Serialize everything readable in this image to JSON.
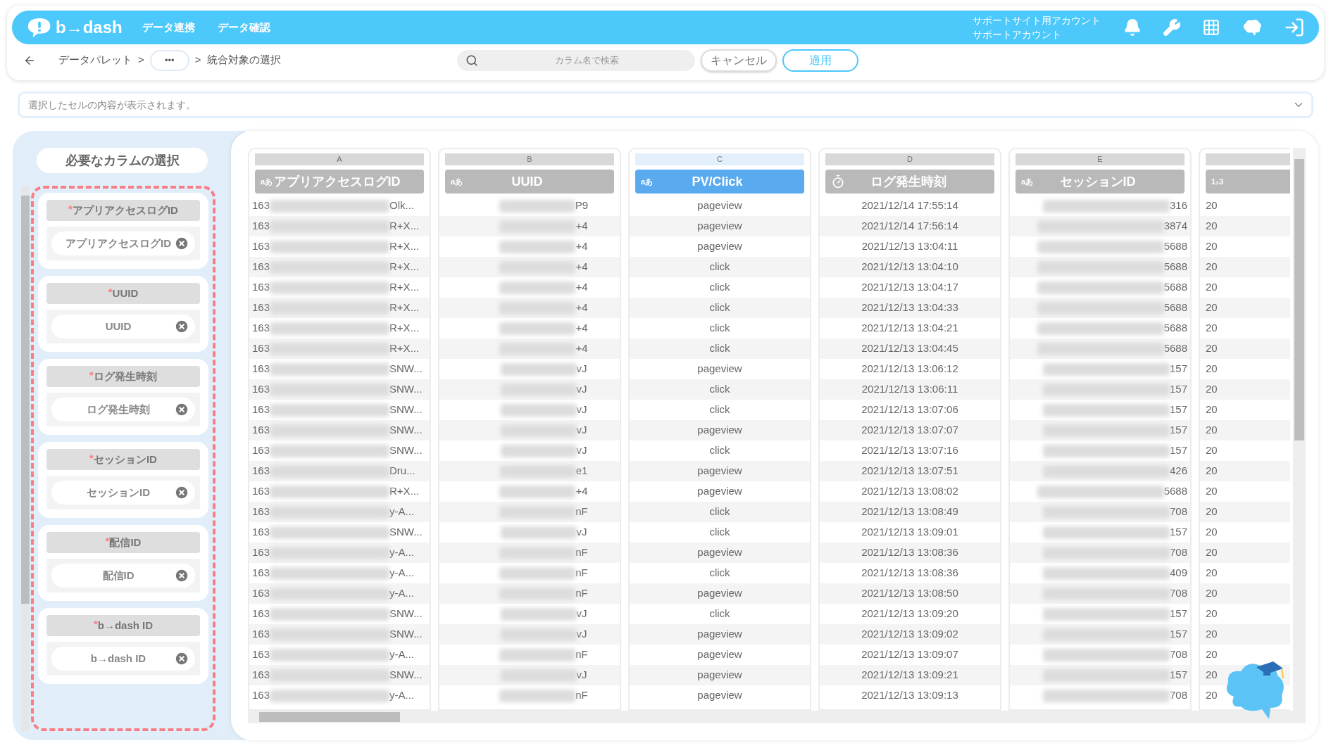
{
  "header": {
    "logo": "b→dash",
    "nav": [
      {
        "label": "データ連携"
      },
      {
        "label": "データ確認"
      }
    ],
    "account": [
      "サポートサイト用アカウント",
      "サポートアカウント"
    ]
  },
  "breadcrumb": {
    "items": [
      "データパレット",
      ">",
      "•••",
      ">",
      "統合対象の選択"
    ]
  },
  "search": {
    "placeholder": "カラム名で検索"
  },
  "buttons": [
    {
      "label": "キャンセル",
      "kind": "secondary"
    },
    {
      "label": "適用",
      "kind": "primary"
    }
  ],
  "cell_content": {
    "placeholder": "選択したセルの内容が表示されます。"
  },
  "column_panel": {
    "title": "必要なカラムの選択",
    "items": [
      {
        "mark": "*",
        "label": "アプリアクセスログID",
        "value": "アプリアクセスログID"
      },
      {
        "mark": "*",
        "label": "UUID",
        "value": "UUID"
      },
      {
        "mark": "*",
        "label": "ログ発生時刻",
        "value": "ログ発生時刻"
      },
      {
        "mark": "*",
        "label": "セッションID",
        "value": "セッションID"
      },
      {
        "mark": "*",
        "label": "配信ID",
        "value": "配信ID"
      },
      {
        "mark": "*",
        "label": "b→dash ID",
        "value": "b→dash ID"
      }
    ]
  },
  "table": {
    "columns": [
      {
        "letter": "A",
        "name": "アプリアクセスログID",
        "kind": "text",
        "type_label": "aあ",
        "selected": false
      },
      {
        "letter": "B",
        "name": "UUID",
        "kind": "text",
        "type_label": "aあ",
        "selected": false
      },
      {
        "letter": "C",
        "name": "PV/Click",
        "kind": "text",
        "type_label": "aあ",
        "selected": true
      },
      {
        "letter": "D",
        "name": "ログ発生時刻",
        "kind": "datetime",
        "selected": false
      },
      {
        "letter": "E",
        "name": "セッションID",
        "kind": "text",
        "type_label": "aあ",
        "selected": false
      },
      {
        "kind": "number",
        "type_label": "1₂3",
        "selected": false
      }
    ],
    "rows": [
      [
        [
          "163",
          "Olk..."
        ],
        "P9",
        "pageview",
        "2021/12/14 17:55:14",
        "316",
        "20"
      ],
      [
        [
          "163",
          "R+X..."
        ],
        "+4",
        "pageview",
        "2021/12/14 17:56:14",
        "3874",
        "20"
      ],
      [
        [
          "163",
          "R+X..."
        ],
        "+4",
        "pageview",
        "2021/12/13 13:04:11",
        "5688",
        "20"
      ],
      [
        [
          "163",
          "R+X..."
        ],
        "+4",
        "click",
        "2021/12/13 13:04:10",
        "5688",
        "20"
      ],
      [
        [
          "163",
          "R+X..."
        ],
        "+4",
        "click",
        "2021/12/13 13:04:17",
        "5688",
        "20"
      ],
      [
        [
          "163",
          "R+X..."
        ],
        "+4",
        "click",
        "2021/12/13 13:04:33",
        "5688",
        "20"
      ],
      [
        [
          "163",
          "R+X..."
        ],
        "+4",
        "click",
        "2021/12/13 13:04:21",
        "5688",
        "20"
      ],
      [
        [
          "163",
          "R+X..."
        ],
        "+4",
        "click",
        "2021/12/13 13:04:45",
        "5688",
        "20"
      ],
      [
        [
          "163",
          "SNW..."
        ],
        "vJ",
        "pageview",
        "2021/12/13 13:06:12",
        "157",
        "20"
      ],
      [
        [
          "163",
          "SNW..."
        ],
        "vJ",
        "click",
        "2021/12/13 13:06:11",
        "157",
        "20"
      ],
      [
        [
          "163",
          "SNW..."
        ],
        "vJ",
        "click",
        "2021/12/13 13:07:06",
        "157",
        "20"
      ],
      [
        [
          "163",
          "SNW..."
        ],
        "vJ",
        "pageview",
        "2021/12/13 13:07:07",
        "157",
        "20"
      ],
      [
        [
          "163",
          "SNW..."
        ],
        "vJ",
        "click",
        "2021/12/13 13:07:16",
        "157",
        "20"
      ],
      [
        [
          "163",
          "Dru..."
        ],
        "e1",
        "pageview",
        "2021/12/13 13:07:51",
        "426",
        "20"
      ],
      [
        [
          "163",
          "R+X..."
        ],
        "+4",
        "pageview",
        "2021/12/13 13:08:02",
        "5688",
        "20"
      ],
      [
        [
          "163",
          "y-A..."
        ],
        "nF",
        "click",
        "2021/12/13 13:08:49",
        "708",
        "20"
      ],
      [
        [
          "163",
          "SNW..."
        ],
        "vJ",
        "click",
        "2021/12/13 13:09:01",
        "157",
        "20"
      ],
      [
        [
          "163",
          "y-A..."
        ],
        "nF",
        "pageview",
        "2021/12/13 13:08:36",
        "708",
        "20"
      ],
      [
        [
          "163",
          "y-A..."
        ],
        "nF",
        "click",
        "2021/12/13 13:08:36",
        "409",
        "20"
      ],
      [
        [
          "163",
          "y-A..."
        ],
        "nF",
        "pageview",
        "2021/12/13 13:08:50",
        "708",
        "20"
      ],
      [
        [
          "163",
          "SNW..."
        ],
        "vJ",
        "click",
        "2021/12/13 13:09:20",
        "157",
        "20"
      ],
      [
        [
          "163",
          "SNW..."
        ],
        "vJ",
        "pageview",
        "2021/12/13 13:09:02",
        "157",
        "20"
      ],
      [
        [
          "163",
          "y-A..."
        ],
        "nF",
        "pageview",
        "2021/12/13 13:09:07",
        "708",
        "20"
      ],
      [
        [
          "163",
          "SNW..."
        ],
        "vJ",
        "pageview",
        "2021/12/13 13:09:21",
        "157",
        "20"
      ],
      [
        [
          "163",
          "y-A..."
        ],
        "nF",
        "pageview",
        "2021/12/13 13:09:13",
        "708",
        "20"
      ]
    ]
  }
}
